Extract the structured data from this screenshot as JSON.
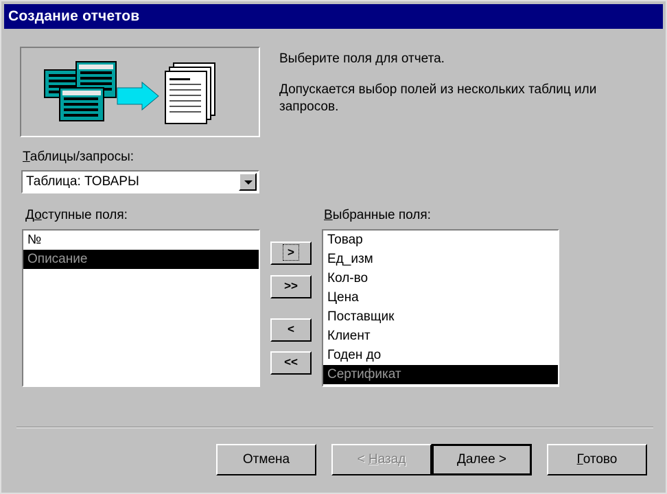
{
  "window": {
    "title": "Создание отчетов"
  },
  "description": {
    "line1": "Выберите поля для отчета.",
    "line2": "Допускается выбор полей из нескольких таблиц или запросов."
  },
  "tables_label": {
    "mnemonic": "Т",
    "rest": "аблицы/запросы:"
  },
  "tables_combo": {
    "value": "Таблица: ТОВАРЫ"
  },
  "available": {
    "label_before": "Д",
    "label_mnemonic": "о",
    "label_after": "ступные поля:",
    "items": [
      {
        "label": "№",
        "selected": false
      },
      {
        "label": "Описание",
        "selected": true
      }
    ]
  },
  "selected": {
    "label_mnemonic": "В",
    "label_rest": "ыбранные поля:",
    "items": [
      {
        "label": "Товар",
        "selected": false
      },
      {
        "label": "Ед_изм",
        "selected": false
      },
      {
        "label": "Кол-во",
        "selected": false
      },
      {
        "label": "Цена",
        "selected": false
      },
      {
        "label": "Поставщик",
        "selected": false
      },
      {
        "label": "Клиент",
        "selected": false
      },
      {
        "label": "Годен до",
        "selected": false
      },
      {
        "label": "Сертификат",
        "selected": true
      }
    ]
  },
  "move_buttons": {
    "add_one": ">",
    "add_all": ">>",
    "remove_one": "<",
    "remove_all": "<<"
  },
  "buttons": {
    "cancel": "Отмена",
    "back_prefix": "< ",
    "back_mnemonic": "Н",
    "back_rest": "азад",
    "next_mnemonic": "Д",
    "next_rest": "алее >",
    "finish_mnemonic": "Г",
    "finish_rest": "отово"
  }
}
